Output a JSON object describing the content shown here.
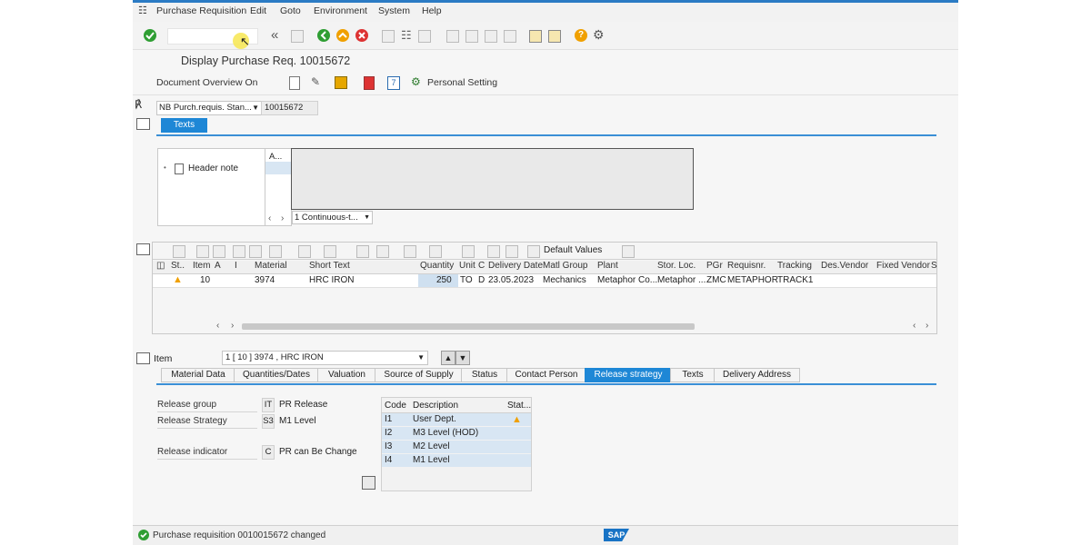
{
  "menu": {
    "items": [
      "Purchase Requisition",
      "Edit",
      "Goto",
      "Environment",
      "System",
      "Help"
    ]
  },
  "page": {
    "title": "Display Purchase Req. 10015672"
  },
  "app_toolbar": {
    "document_overview": "Document Overview On",
    "personal_setting": "Personal Setting"
  },
  "header": {
    "doc_type": "NB Purch.requis. Stan...",
    "doc_number": "10015672"
  },
  "texts_section": {
    "tab": "Texts",
    "col_a": "A...",
    "header_note": "Header note",
    "format": "1 Continuous-t..."
  },
  "item_grid": {
    "toolbar_default_values": "Default Values",
    "columns": [
      "St..",
      "Item",
      "A",
      "I",
      "Material",
      "Short Text",
      "Quantity",
      "Unit",
      "C",
      "Delivery Date",
      "Matl Group",
      "Plant",
      "Stor. Loc.",
      "PGr",
      "Requisnr.",
      "Tracking",
      "Des.Vendor",
      "Fixed Vendor",
      "S"
    ],
    "row": {
      "item": "10",
      "material": "3974",
      "short_text": "HRC IRON",
      "quantity": "250",
      "unit": "TO",
      "c": "D",
      "delivery_date": "23.05.2023",
      "matl_group": "Mechanics",
      "plant": "Metaphor Co...",
      "stor_loc": "Metaphor ...",
      "pgr": "ZMC",
      "requisnr": "METAPHOR",
      "tracking": "TRACK1"
    }
  },
  "item_detail": {
    "label": "Item",
    "selected": "1 [ 10 ] 3974 , HRC IRON",
    "tabs": [
      "Material Data",
      "Quantities/Dates",
      "Valuation",
      "Source of Supply",
      "Status",
      "Contact Person",
      "Release strategy",
      "Texts",
      "Delivery Address"
    ],
    "active_tab": "Release strategy"
  },
  "release": {
    "group_label": "Release group",
    "group_value": "IT",
    "group_text": "PR Release",
    "strategy_label": "Release Strategy",
    "strategy_value": "S3",
    "strategy_text": "M1 Level",
    "indicator_label": "Release indicator",
    "indicator_value": "C",
    "indicator_text": "PR can Be Change",
    "table_headers": {
      "code": "Code",
      "description": "Description",
      "status": "Stat..."
    },
    "rows": [
      {
        "code": "I1",
        "description": "User Dept."
      },
      {
        "code": "I2",
        "description": "M3 Level (HOD)"
      },
      {
        "code": "I3",
        "description": "M2 Level"
      },
      {
        "code": "I4",
        "description": "M1 Level"
      }
    ]
  },
  "status_bar": {
    "message": "Purchase requisition 0010015672 changed",
    "logo": "SAP"
  },
  "colors": {
    "accent": "#1e87d6",
    "ok_green": "#2f9e33",
    "warning": "#f0a000",
    "error_red": "#d33"
  }
}
